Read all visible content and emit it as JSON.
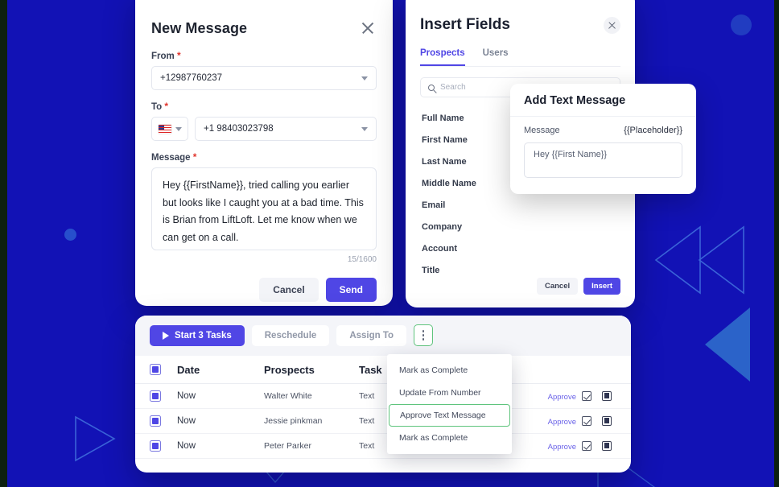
{
  "background": {
    "color": "#1212b5",
    "edge_color": "#0d2010",
    "accent": "#4f46e5",
    "green_outline": "#5fc47d"
  },
  "new_message": {
    "title": "New Message",
    "close_icon": "close-icon",
    "from": {
      "label": "From",
      "required": "*",
      "value": "+12987760237"
    },
    "to": {
      "label": "To",
      "required": "*",
      "country_flag": "us-flag-icon",
      "value": "+1 98403023798"
    },
    "message": {
      "label": "Message",
      "required": "*",
      "value": "Hey {{FirstName}}, tried calling you earlier but looks like I caught you at a bad time. This is Brian from LiftLoft. Let me know when we can get on a call.",
      "char_count": "15/1600"
    },
    "cancel_label": "Cancel",
    "send_label": "Send"
  },
  "insert_fields": {
    "title": "Insert Fields",
    "close_icon": "close-icon",
    "tabs": [
      {
        "label": "Prospects",
        "active": true
      },
      {
        "label": "Users",
        "active": false
      }
    ],
    "search": {
      "icon": "search-icon",
      "placeholder": "Search",
      "value": ""
    },
    "fields": [
      "Full Name",
      "First Name",
      "Last Name",
      "Middle Name",
      "Email",
      "Company",
      "Account",
      "Title"
    ],
    "cancel_label": "Cancel",
    "insert_label": "Insert"
  },
  "add_text_message": {
    "title": "Add Text Message",
    "message_label": "Message",
    "placeholder_token": "{{Placeholder}}",
    "input_value": "Hey {{First Name}}"
  },
  "tasks": {
    "toolbar": {
      "start_label": "Start 3 Tasks",
      "start_icon": "play-icon",
      "reschedule_label": "Reschedule",
      "assign_label": "Assign To",
      "kebab_icon": "more-vertical-icon"
    },
    "columns": [
      "Date",
      "Prospects",
      "Task"
    ],
    "rows": [
      {
        "date": "Now",
        "prospect": "Walter White",
        "task": "Text",
        "approve": "Approve"
      },
      {
        "date": "Now",
        "prospect": "Jessie pinkman",
        "task": "Text",
        "approve": "Approve"
      },
      {
        "date": "Now",
        "prospect": "Peter Parker",
        "task": "Text",
        "approve": "Approve"
      }
    ]
  },
  "context_menu": {
    "items": [
      {
        "label": "Mark as Complete",
        "highlighted": false
      },
      {
        "label": "Update From Number",
        "highlighted": false
      },
      {
        "label": "Approve Text Message",
        "highlighted": true
      },
      {
        "label": "Mark as Complete",
        "highlighted": false
      }
    ]
  }
}
